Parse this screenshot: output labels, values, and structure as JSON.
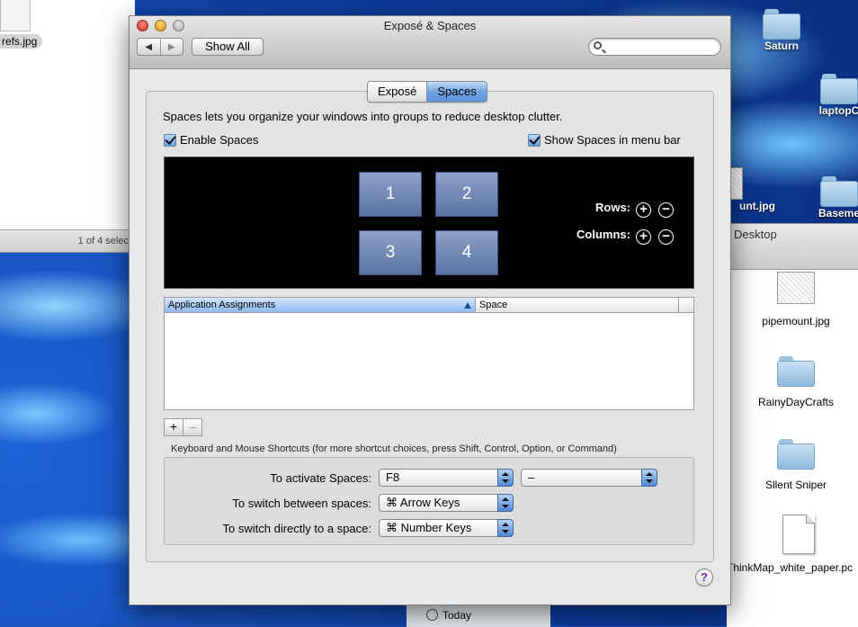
{
  "desktop": {
    "left_finder": {
      "file_label": "refs.jpg",
      "status": "1 of 4 select"
    },
    "right_finder": {
      "title": "Desktop"
    },
    "sidebar_item": "Today",
    "icons": [
      {
        "label": "Saturn",
        "kind": "folder"
      },
      {
        "label": "laptopC",
        "kind": "folder"
      },
      {
        "label": "unt.jpg",
        "kind": "image"
      },
      {
        "label": "Baseme",
        "kind": "folder"
      },
      {
        "label": "pipemount.jpg",
        "kind": "image"
      },
      {
        "label": "RainyDayCrafts",
        "kind": "folder"
      },
      {
        "label": "Sllent Sniper",
        "kind": "folder"
      },
      {
        "label": "ThinkMap_white_paper.pc",
        "kind": "document"
      }
    ]
  },
  "window": {
    "title": "Exposé & Spaces",
    "show_all": "Show All",
    "search_placeholder": "",
    "tabs": [
      {
        "label": "Exposé",
        "selected": false
      },
      {
        "label": "Spaces",
        "selected": true
      }
    ],
    "description": "Spaces lets you organize your windows into groups to reduce desktop clutter.",
    "enable_spaces": {
      "label": "Enable Spaces",
      "checked": true
    },
    "show_menu_bar": {
      "label": "Show Spaces in menu bar",
      "checked": true
    },
    "spaces": [
      "1",
      "2",
      "3",
      "4"
    ],
    "rows_label": "Rows:",
    "columns_label": "Columns:",
    "table": {
      "col_app": "Application Assignments",
      "col_space": "Space",
      "rows": []
    },
    "add_label": "+",
    "remove_label": "–",
    "shortcuts_caption": "Keyboard and Mouse Shortcuts (for more shortcut choices, press Shift, Control, Option, or Command)",
    "shortcuts": {
      "activate_label": "To activate Spaces:",
      "activate_key": "F8",
      "activate_mouse": "–",
      "switch_label": "To switch between spaces:",
      "switch_value": "⌘ Arrow Keys",
      "direct_label": "To switch directly to a space:",
      "direct_value": "⌘ Number Keys"
    },
    "help_label": "?"
  },
  "colors": {
    "selected_tab": "#6fa3e3",
    "space_tile": "#7a8fba",
    "grid_background": "#000000",
    "help_glyph": "#6a2bb8"
  }
}
